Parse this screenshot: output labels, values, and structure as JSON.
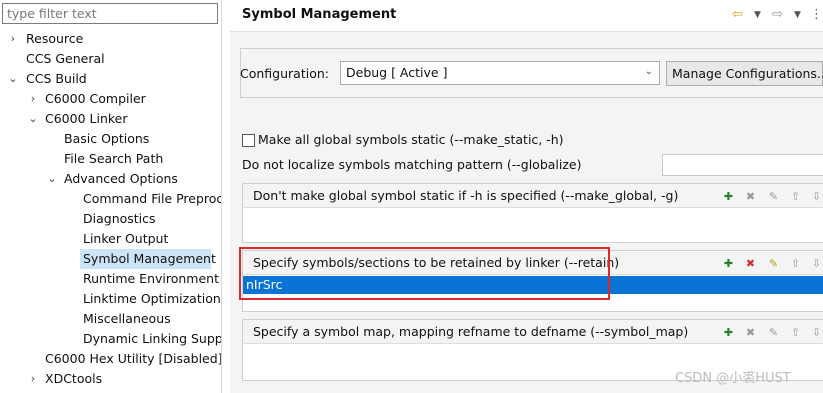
{
  "filter": {
    "placeholder": "type filter text"
  },
  "tree": {
    "resource": "Resource",
    "ccs_general": "CCS General",
    "ccs_build": "CCS Build",
    "c6000_compiler": "C6000 Compiler",
    "c6000_linker": "C6000 Linker",
    "basic_options": "Basic Options",
    "file_search_path": "File Search Path",
    "advanced_options": "Advanced Options",
    "command_file": "Command File Preproce",
    "diagnostics": "Diagnostics",
    "linker_output": "Linker Output",
    "symbol_management": "Symbol Management",
    "runtime_environment": "Runtime Environment",
    "linktime_optimization": "Linktime Optimization",
    "miscellaneous": "Miscellaneous",
    "dynamic_linking": "Dynamic Linking Suppo",
    "hex_utility": "C6000 Hex Utility  [Disabled]",
    "xdctools": "XDCtools"
  },
  "header": {
    "title": "Symbol Management"
  },
  "configuration": {
    "label": "Configuration:",
    "value": "Debug  [ Active ]",
    "manage_label": "Manage Configurations..."
  },
  "options": {
    "make_static_label": "Make all global symbols static (--make_static, -h)",
    "make_static_checked": false,
    "globalize_label": "Do not localize symbols matching pattern (--globalize)",
    "globalize_value": ""
  },
  "lists": {
    "make_global": {
      "title": "Don't make global symbol static if -h is specified (--make_global, -g)",
      "items": []
    },
    "retain": {
      "title": "Specify symbols/sections to be retained by linker (--retain)",
      "items": [
        "nIrSrc"
      ]
    },
    "symbol_map": {
      "title": "Specify a symbol map, mapping refname to defname (--symbol_map)",
      "items": []
    }
  },
  "watermark": "CSDN @小裘HUST",
  "colors": {
    "selection": "#0a74d6",
    "highlight_box": "#e0272b",
    "tree_selection": "#cce4f7"
  }
}
